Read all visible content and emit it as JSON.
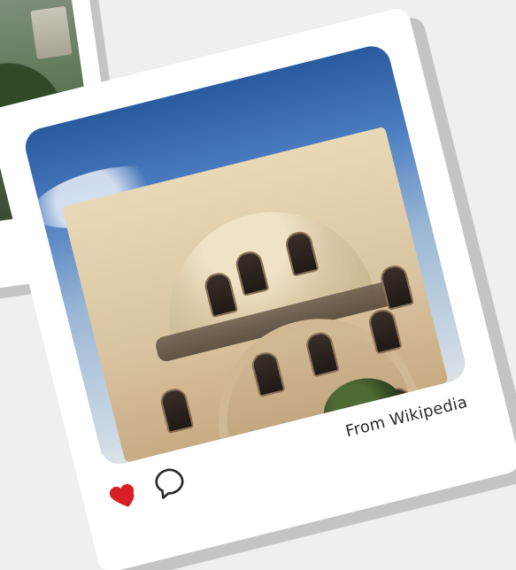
{
  "post": {
    "caption": "From Wikipedia",
    "icons": {
      "like": "heart-icon",
      "comment": "comment-icon"
    },
    "colors": {
      "heart": "#d81f26",
      "card": "#ffffff",
      "background": "#efefef"
    }
  }
}
